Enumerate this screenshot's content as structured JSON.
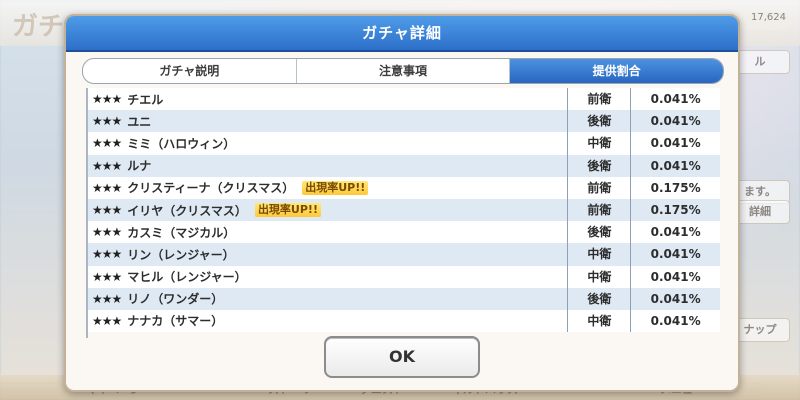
{
  "background": {
    "title": "ガチャ",
    "counter": "17,624",
    "right_buttons": [
      "ル",
      "ます。",
      "詳細",
      "ナップ"
    ],
    "bottom_tabs": [
      "マイページ",
      "ストーリー",
      "クエスト",
      "ギルドハウス",
      "メニュー"
    ]
  },
  "dialog": {
    "title": "ガチャ詳細",
    "tabs": [
      {
        "label": "ガチャ説明",
        "active": false
      },
      {
        "label": "注意事項",
        "active": false
      },
      {
        "label": "提供割合",
        "active": true
      }
    ],
    "rows": [
      {
        "stars": "★★★",
        "name": "チエル",
        "badge": "",
        "position": "前衛",
        "rate": "0.041%"
      },
      {
        "stars": "★★★",
        "name": "ユニ",
        "badge": "",
        "position": "後衛",
        "rate": "0.041%"
      },
      {
        "stars": "★★★",
        "name": "ミミ（ハロウィン）",
        "badge": "",
        "position": "中衛",
        "rate": "0.041%"
      },
      {
        "stars": "★★★",
        "name": "ルナ",
        "badge": "",
        "position": "後衛",
        "rate": "0.041%"
      },
      {
        "stars": "★★★",
        "name": "クリスティーナ（クリスマス）",
        "badge": "出現率UP!!",
        "position": "前衛",
        "rate": "0.175%"
      },
      {
        "stars": "★★★",
        "name": "イリヤ（クリスマス）",
        "badge": "出現率UP!!",
        "position": "前衛",
        "rate": "0.175%"
      },
      {
        "stars": "★★★",
        "name": "カスミ（マジカル）",
        "badge": "",
        "position": "後衛",
        "rate": "0.041%"
      },
      {
        "stars": "★★★",
        "name": "リン（レンジャー）",
        "badge": "",
        "position": "中衛",
        "rate": "0.041%"
      },
      {
        "stars": "★★★",
        "name": "マヒル（レンジャー）",
        "badge": "",
        "position": "中衛",
        "rate": "0.041%"
      },
      {
        "stars": "★★★",
        "name": "リノ（ワンダー）",
        "badge": "",
        "position": "後衛",
        "rate": "0.041%"
      },
      {
        "stars": "★★★",
        "name": "ナナカ（サマー）",
        "badge": "",
        "position": "中衛",
        "rate": "0.041%"
      }
    ],
    "ok_label": "OK"
  },
  "colors": {
    "header_blue": "#2d6fc9",
    "active_tab_blue": "#2766c0",
    "row_alt": "#dfe9f4",
    "badge_gold": "#ffc83a"
  }
}
